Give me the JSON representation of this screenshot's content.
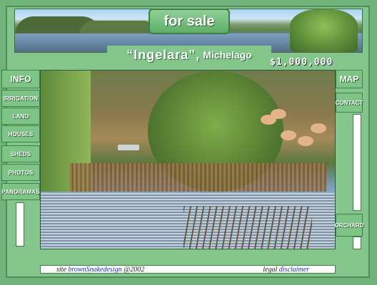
{
  "banner": {
    "for_sale_label": "for sale",
    "property_name": "“Ingelara”,",
    "location": "Michelago",
    "price": "$1,000,000"
  },
  "left_nav": {
    "items": [
      {
        "label": "INFO"
      },
      {
        "label": "IRRIGATION"
      },
      {
        "label": "LAND"
      },
      {
        "label": "HOUSES"
      },
      {
        "label": "SHEDS"
      },
      {
        "label": "PHOTOS"
      },
      {
        "label": "PANORAMAS"
      }
    ]
  },
  "right_nav": {
    "items": [
      {
        "label": "MAP"
      },
      {
        "label": "CONTACT"
      },
      {
        "label": "ORCHARD"
      }
    ]
  },
  "footer": {
    "site_prefix": "site",
    "designer_link": "brownSnakedesign",
    "year": "@2002",
    "legal_prefix": "legal",
    "disclaimer_link": "disclaimer"
  },
  "colors": {
    "background": "#83c58b",
    "button": "#7fc487",
    "link": "#1a2fc0"
  }
}
